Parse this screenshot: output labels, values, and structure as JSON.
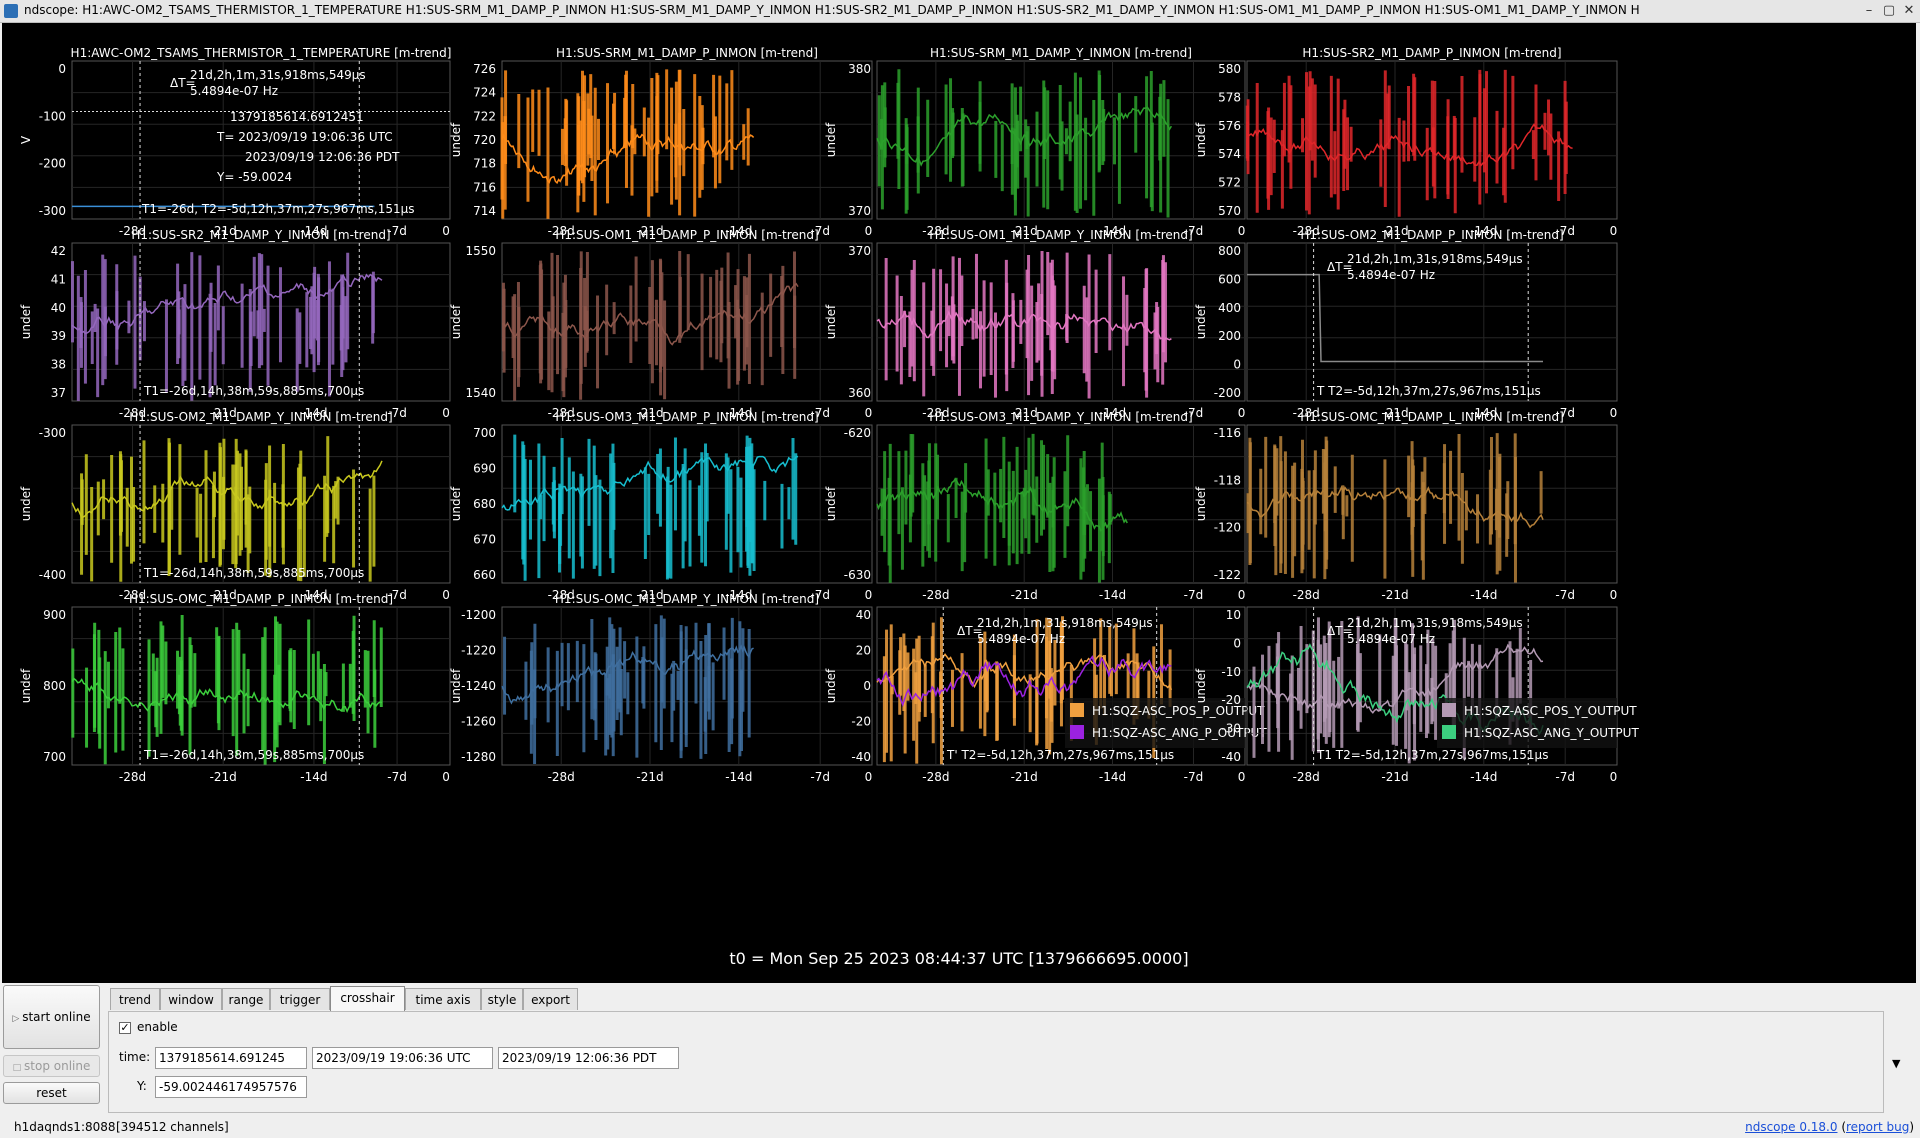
{
  "window": {
    "title": "ndscope: H1:AWC-OM2_TSAMS_THERMISTOR_1_TEMPERATURE H1:SUS-SRM_M1_DAMP_P_INMON H1:SUS-SRM_M1_DAMP_Y_INMON H1:SUS-SR2_M1_DAMP_P_INMON H1:SUS-SR2_M1_DAMP_Y_INMON H1:SUS-OM1_M1_DAMP_P_INMON H1:SUS-OM1_M1_DAMP_Y_INMON H",
    "buttons": [
      "–",
      "▢",
      "✕"
    ]
  },
  "shared_x_ticks": [
    "-28d",
    "-21d",
    "-14d",
    "-7d",
    "0"
  ],
  "plots": [
    {
      "title": "H1:AWC-OM2_TSAMS_THERMISTOR_1_TEMPERATURE [m-trend]",
      "ylabel": "V",
      "yticks": [
        "0",
        "-100",
        "-200",
        "-300"
      ],
      "color": "#3a8fd8",
      "annotations": [
        "ΔT=",
        "21d,2h,1m,31s,918ms,549µs",
        "5.4894e-07 Hz",
        "1379185614.6912451",
        "T= 2023/09/19 19:06:36 UTC",
        "2023/09/19 12:06:36 PDT",
        "Y= -59.0024",
        "T1=-26d, T2=-5d,12h,37m,27s,967ms,151µs"
      ]
    },
    {
      "title": "H1:SUS-SRM_M1_DAMP_P_INMON [m-trend]",
      "ylabel": "undef",
      "yticks": [
        "726",
        "724",
        "722",
        "720",
        "718",
        "716",
        "714"
      ],
      "color": "#ff8c1a",
      "annotations": []
    },
    {
      "title": "H1:SUS-SRM_M1_DAMP_Y_INMON [m-trend]",
      "ylabel": "undef",
      "yticks": [
        "380",
        "370"
      ],
      "color": "#2ca02c",
      "annotations": []
    },
    {
      "title": "H1:SUS-SR2_M1_DAMP_P_INMON [m-trend]",
      "ylabel": "undef",
      "yticks": [
        "580",
        "578",
        "576",
        "574",
        "572",
        "570"
      ],
      "color": "#e0272a",
      "annotations": []
    },
    {
      "title": "H1:SUS-SR2_M1_DAMP_Y_INMON [m-trend]",
      "ylabel": "undef",
      "yticks": [
        "42",
        "41",
        "40",
        "39",
        "38",
        "37"
      ],
      "color": "#9467bd",
      "annotations": [
        "T1=-26d,14h,38m,59s,885ms,700µs"
      ]
    },
    {
      "title": "H1:SUS-OM1_M1_DAMP_P_INMON [m-trend]",
      "ylabel": "undef",
      "yticks": [
        "1550",
        "1540"
      ],
      "color": "#8c564b",
      "annotations": []
    },
    {
      "title": "H1:SUS-OM1_M1_DAMP_Y_INMON [m-trend]",
      "ylabel": "undef",
      "yticks": [
        "370",
        "360"
      ],
      "color": "#e377c2",
      "annotations": []
    },
    {
      "title": "H1:SUS-OM2_M1_DAMP_P_INMON [m-trend]",
      "ylabel": "undef",
      "yticks": [
        "800",
        "600",
        "400",
        "200",
        "0",
        "-200"
      ],
      "color": "#8a8a8a",
      "annotations": [
        "ΔT=",
        "21d,2h,1m,31s,918ms,549µs",
        "5.4894e-07 Hz",
        "T T2=-5d,12h,37m,27s,967ms,151µs"
      ]
    },
    {
      "title": "H1:SUS-OM2_M1_DAMP_Y_INMON [m-trend]",
      "ylabel": "undef",
      "yticks": [
        "-300",
        "-400"
      ],
      "color": "#c8c81e",
      "annotations": [
        "T1=-26d,14h,38m,59s,885ms,700µs"
      ]
    },
    {
      "title": "H1:SUS-OM3_M1_DAMP_P_INMON [m-trend]",
      "ylabel": "undef",
      "yticks": [
        "700",
        "690",
        "680",
        "670",
        "660"
      ],
      "color": "#17becf",
      "annotations": []
    },
    {
      "title": "H1:SUS-OM3_M1_DAMP_Y_INMON [m-trend]",
      "ylabel": "undef",
      "yticks": [
        "-620",
        "-630"
      ],
      "color": "#2ca02c",
      "annotations": []
    },
    {
      "title": "H1:SUS-OMC_M1_DAMP_L_INMON [m-trend]",
      "ylabel": "undef",
      "yticks": [
        "-116",
        "-118",
        "-120",
        "-122"
      ],
      "color": "#b5803a",
      "annotations": []
    },
    {
      "title": "H1:SUS-OMC_M1_DAMP_P_INMON [m-trend]",
      "ylabel": "undef",
      "yticks": [
        "900",
        "800",
        "700"
      ],
      "color": "#3ccf3c",
      "annotations": [
        "T1=-26d,14h,38m,59s,885ms,700µs"
      ]
    },
    {
      "title": "H1:SUS-OMC_M1_DAMP_Y_INMON [m-trend]",
      "ylabel": "undef",
      "yticks": [
        "-1200",
        "-1220",
        "-1240",
        "-1260",
        "-1280"
      ],
      "color": "#3f6f9f",
      "annotations": []
    },
    {
      "title": "",
      "ylabel": "undef",
      "yticks": [
        "40",
        "20",
        "0",
        "-20",
        "-40"
      ],
      "color": "#f0a040",
      "color2": "#9b22e0",
      "legend": [
        "H1:SQZ-ASC_POS_P_OUTPUT",
        "H1:SQZ-ASC_ANG_P_OUTPUT"
      ],
      "annotations": [
        "ΔT=",
        "21d,2h,1m,31s,918ms,549µs",
        "5.4894e-07 Hz",
        "T' T2=-5d,12h,37m,27s,967ms,151µs"
      ]
    },
    {
      "title": "",
      "ylabel": "undef",
      "yticks": [
        "10",
        "0",
        "-10",
        "-20",
        "-30",
        "-40"
      ],
      "color": "#b49ab4",
      "color2": "#3ccf80",
      "legend": [
        "H1:SQZ-ASC_POS_Y_OUTPUT",
        "H1:SQZ-ASC_ANG_Y_OUTPUT"
      ],
      "annotations": [
        "ΔT=",
        "21d,2h,1m,31s,918ms,549µs",
        "5.4894e-07 Hz",
        "T1 T2=-5d,12h,37m,27s,967ms,151µs"
      ]
    }
  ],
  "t0": "t0 = Mon Sep 25 2023 08:44:37 UTC [1379666695.0000]",
  "controls": {
    "start_online": "start online",
    "stop_online": "stop online",
    "reset": "reset",
    "tabs": [
      "trend",
      "window",
      "range",
      "trigger",
      "crosshair",
      "time axis",
      "style",
      "export"
    ],
    "active_tab": "crosshair",
    "enable_label": "enable",
    "enable_checked": true,
    "time_label": "time:",
    "time_gps": "1379185614.691245",
    "time_utc": "2023/09/19 19:06:36 UTC",
    "time_pdt": "2023/09/19 12:06:36 PDT",
    "y_label": "Y:",
    "y_value": "-59.002446174957576"
  },
  "status": {
    "server": "h1daqnds1:8088",
    "channels": "[394512 channels]",
    "version_link": "ndscope 0.18.0",
    "report_bug": "report bug"
  }
}
